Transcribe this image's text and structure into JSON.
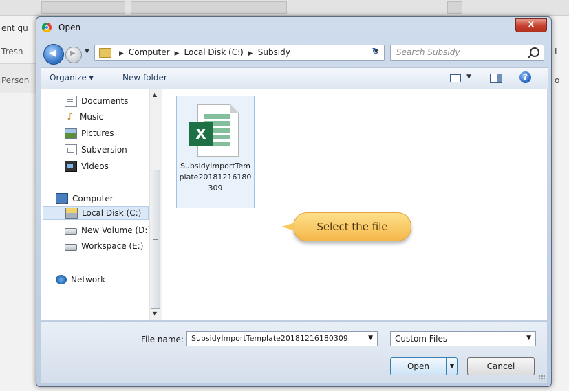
{
  "background": {
    "labels": [
      "ent qu",
      "Tresh",
      "Person"
    ],
    "right_labels": [
      "I",
      "o"
    ]
  },
  "dialog": {
    "title": "Open",
    "close_glyph": "x",
    "address": {
      "breadcrumbs": [
        "Computer",
        "Local Disk (C:)",
        "Subsidy"
      ]
    },
    "search": {
      "placeholder": "Search Subsidy"
    },
    "toolbar": {
      "organize_label": "Organize ▾",
      "new_folder_label": "New folder",
      "help_glyph": "?"
    },
    "nav_items": [
      {
        "label": "Documents",
        "icon": "documents-icon"
      },
      {
        "label": "Music",
        "icon": "music-icon"
      },
      {
        "label": "Pictures",
        "icon": "pictures-icon"
      },
      {
        "label": "Subversion",
        "icon": "subversion-icon"
      },
      {
        "label": "Videos",
        "icon": "videos-icon"
      },
      {
        "label": "Computer",
        "icon": "computer-icon"
      },
      {
        "label": "Local Disk (C:)",
        "icon": "local-disk-icon",
        "selected": true
      },
      {
        "label": "New Volume (D:)",
        "icon": "drive-icon"
      },
      {
        "label": "Workspace (E:)",
        "icon": "drive-icon"
      },
      {
        "label": "Network",
        "icon": "network-icon"
      }
    ],
    "files": [
      {
        "name": "SubsidyImportTemplate20181216180309",
        "type": "excel",
        "icon_letter": "X",
        "selected": true
      }
    ],
    "callout": "Select the file",
    "file_name_label": "File name:",
    "file_name_value": "SubsidyImportTemplate20181216180309",
    "file_type_filter": "Custom Files",
    "open_label": "Open",
    "cancel_label": "Cancel"
  },
  "colors": {
    "title_bar": "#c6d5e8",
    "close_button": "#c7412f",
    "excel_green": "#1e7145",
    "callout": "#f5b84a",
    "selection": "#dbe8f8"
  }
}
